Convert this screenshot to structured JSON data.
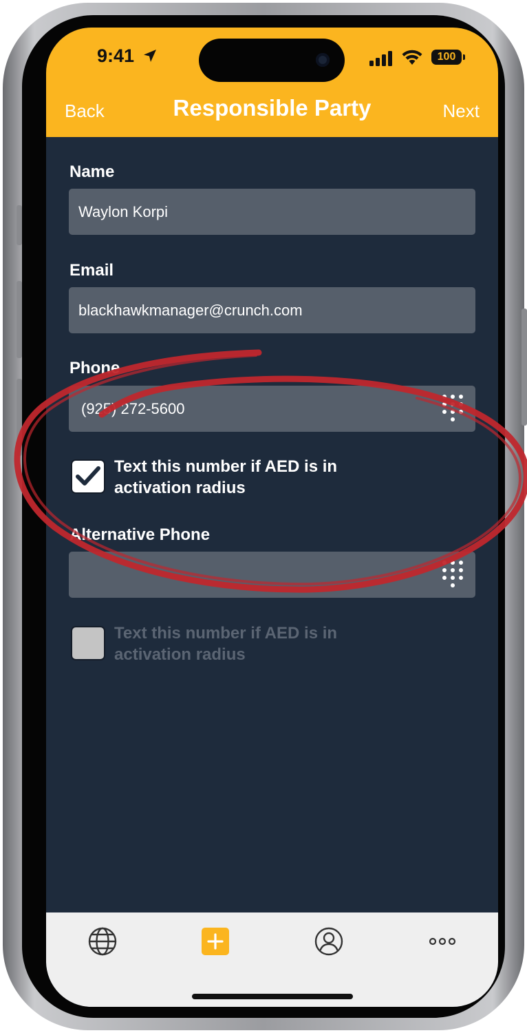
{
  "status": {
    "time": "9:41",
    "battery": "100"
  },
  "nav": {
    "back": "Back",
    "title": "Responsible Party",
    "next": "Next"
  },
  "form": {
    "name_label": "Name",
    "name_value": "Waylon Korpi",
    "email_label": "Email",
    "email_value": "blackhawkmanager@crunch.com",
    "phone_label": "Phone",
    "phone_value": "(925) 272-5600",
    "phone_text_label": "Text this number if AED is in activation radius",
    "phone_text_checked": true,
    "alt_phone_label": "Alternative Phone",
    "alt_phone_value": "",
    "alt_text_label": "Text this number if AED is in activation radius",
    "alt_text_checked": false
  },
  "tabs": [
    {
      "icon": "globe-icon"
    },
    {
      "icon": "plus-icon"
    },
    {
      "icon": "profile-icon"
    },
    {
      "icon": "more-icon"
    }
  ],
  "colors": {
    "header": "#fbb51f",
    "background": "#1e2b3c",
    "field": "#565f6b",
    "annotation": "#c0272d",
    "tabbar": "#efefef"
  }
}
